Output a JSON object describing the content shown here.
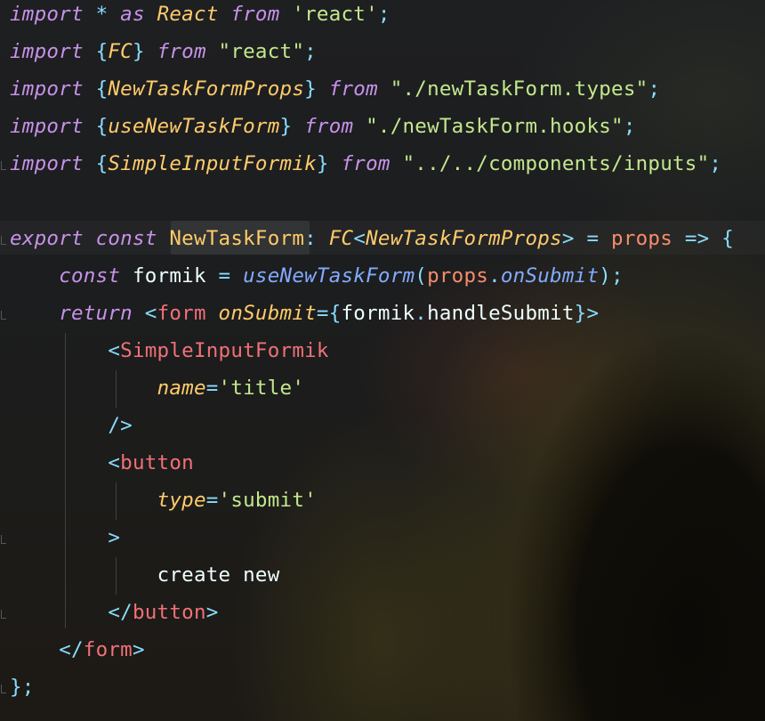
{
  "editor": {
    "language": "typescript-react",
    "colors": {
      "keyword": "#c792ea",
      "string": "#c3e88d",
      "type": "#ffcb6b",
      "operator": "#89ddff",
      "function": "#82aaff",
      "tag": "#f07178",
      "param": "#f78c6c",
      "text": "#eeffff"
    },
    "lines": [
      [
        {
          "t": "import",
          "c": "kw"
        },
        {
          "t": " "
        },
        {
          "t": "*",
          "c": "op"
        },
        {
          "t": " "
        },
        {
          "t": "as",
          "c": "kw"
        },
        {
          "t": " "
        },
        {
          "t": "React",
          "c": "typ"
        },
        {
          "t": " "
        },
        {
          "t": "from",
          "c": "kw"
        },
        {
          "t": " "
        },
        {
          "t": "'react'",
          "c": "str"
        },
        {
          "t": ";",
          "c": "op"
        }
      ],
      [
        {
          "t": "import",
          "c": "kw"
        },
        {
          "t": " "
        },
        {
          "t": "{",
          "c": "op"
        },
        {
          "t": "FC",
          "c": "typ"
        },
        {
          "t": "}",
          "c": "op"
        },
        {
          "t": " "
        },
        {
          "t": "from",
          "c": "kw"
        },
        {
          "t": " "
        },
        {
          "t": "\"react\"",
          "c": "str"
        },
        {
          "t": ";",
          "c": "op"
        }
      ],
      [
        {
          "t": "import",
          "c": "kw"
        },
        {
          "t": " "
        },
        {
          "t": "{",
          "c": "op"
        },
        {
          "t": "NewTaskFormProps",
          "c": "typ"
        },
        {
          "t": "}",
          "c": "op"
        },
        {
          "t": " "
        },
        {
          "t": "from",
          "c": "kw"
        },
        {
          "t": " "
        },
        {
          "t": "\"./newTaskForm.types\"",
          "c": "str"
        },
        {
          "t": ";",
          "c": "op"
        }
      ],
      [
        {
          "t": "import",
          "c": "kw"
        },
        {
          "t": " "
        },
        {
          "t": "{",
          "c": "op"
        },
        {
          "t": "useNewTaskForm",
          "c": "typ"
        },
        {
          "t": "}",
          "c": "op"
        },
        {
          "t": " "
        },
        {
          "t": "from",
          "c": "kw"
        },
        {
          "t": " "
        },
        {
          "t": "\"./newTaskForm.hooks\"",
          "c": "str"
        },
        {
          "t": ";",
          "c": "op"
        }
      ],
      [
        {
          "t": "import",
          "c": "kw"
        },
        {
          "t": " "
        },
        {
          "t": "{",
          "c": "op"
        },
        {
          "t": "SimpleInputFormik",
          "c": "typ"
        },
        {
          "t": "}",
          "c": "op"
        },
        {
          "t": " "
        },
        {
          "t": "from",
          "c": "kw"
        },
        {
          "t": " "
        },
        {
          "t": "\"../../components/inputs\"",
          "c": "str"
        },
        {
          "t": ";",
          "c": "op"
        }
      ],
      [],
      [
        {
          "t": "export",
          "c": "kw"
        },
        {
          "t": " "
        },
        {
          "t": "const",
          "c": "kw"
        },
        {
          "t": " "
        },
        {
          "t": "NewTaskForm",
          "c": "cls"
        },
        {
          "t": ":",
          "c": "op"
        },
        {
          "t": " "
        },
        {
          "t": "FC",
          "c": "typ"
        },
        {
          "t": "<",
          "c": "op"
        },
        {
          "t": "NewTaskFormProps",
          "c": "typ"
        },
        {
          "t": ">",
          "c": "op"
        },
        {
          "t": " "
        },
        {
          "t": "=",
          "c": "op"
        },
        {
          "t": " "
        },
        {
          "t": "props",
          "c": "prm"
        },
        {
          "t": " "
        },
        {
          "t": "=>",
          "c": "op"
        },
        {
          "t": " "
        },
        {
          "t": "{",
          "c": "op"
        }
      ],
      [
        {
          "t": "    "
        },
        {
          "t": "const",
          "c": "kw"
        },
        {
          "t": " "
        },
        {
          "t": "formik",
          "c": "var"
        },
        {
          "t": " "
        },
        {
          "t": "=",
          "c": "op"
        },
        {
          "t": " "
        },
        {
          "t": "useNewTaskForm",
          "c": "fn"
        },
        {
          "t": "(",
          "c": "op"
        },
        {
          "t": "props",
          "c": "prm"
        },
        {
          "t": ".",
          "c": "op"
        },
        {
          "t": "onSubmit",
          "c": "fn"
        },
        {
          "t": ");",
          "c": "op"
        }
      ],
      [
        {
          "t": "    "
        },
        {
          "t": "return",
          "c": "kw"
        },
        {
          "t": " "
        },
        {
          "t": "<",
          "c": "op"
        },
        {
          "t": "form",
          "c": "tag"
        },
        {
          "t": " "
        },
        {
          "t": "onSubmit",
          "c": "attr"
        },
        {
          "t": "={",
          "c": "op"
        },
        {
          "t": "formik",
          "c": "var"
        },
        {
          "t": ".",
          "c": "op"
        },
        {
          "t": "handleSubmit",
          "c": "var"
        },
        {
          "t": "}>",
          "c": "op"
        }
      ],
      [
        {
          "t": "        "
        },
        {
          "t": "<",
          "c": "op"
        },
        {
          "t": "SimpleInputFormik",
          "c": "tag"
        }
      ],
      [
        {
          "t": "            "
        },
        {
          "t": "name",
          "c": "attr"
        },
        {
          "t": "=",
          "c": "op"
        },
        {
          "t": "'title'",
          "c": "str"
        }
      ],
      [
        {
          "t": "        "
        },
        {
          "t": "/>",
          "c": "op"
        }
      ],
      [
        {
          "t": "        "
        },
        {
          "t": "<",
          "c": "op"
        },
        {
          "t": "button",
          "c": "tag"
        }
      ],
      [
        {
          "t": "            "
        },
        {
          "t": "type",
          "c": "attr"
        },
        {
          "t": "=",
          "c": "op"
        },
        {
          "t": "'submit'",
          "c": "str"
        }
      ],
      [
        {
          "t": "        "
        },
        {
          "t": ">",
          "c": "op"
        }
      ],
      [
        {
          "t": "            "
        },
        {
          "t": "create new",
          "c": "pl"
        }
      ],
      [
        {
          "t": "        "
        },
        {
          "t": "</",
          "c": "op"
        },
        {
          "t": "button",
          "c": "tag"
        },
        {
          "t": ">",
          "c": "op"
        }
      ],
      [
        {
          "t": "    "
        },
        {
          "t": "</",
          "c": "op"
        },
        {
          "t": "form",
          "c": "tag"
        },
        {
          "t": ">",
          "c": "op"
        }
      ],
      [
        {
          "t": "}",
          "c": "op"
        },
        {
          "t": ";",
          "c": "op"
        }
      ]
    ]
  }
}
